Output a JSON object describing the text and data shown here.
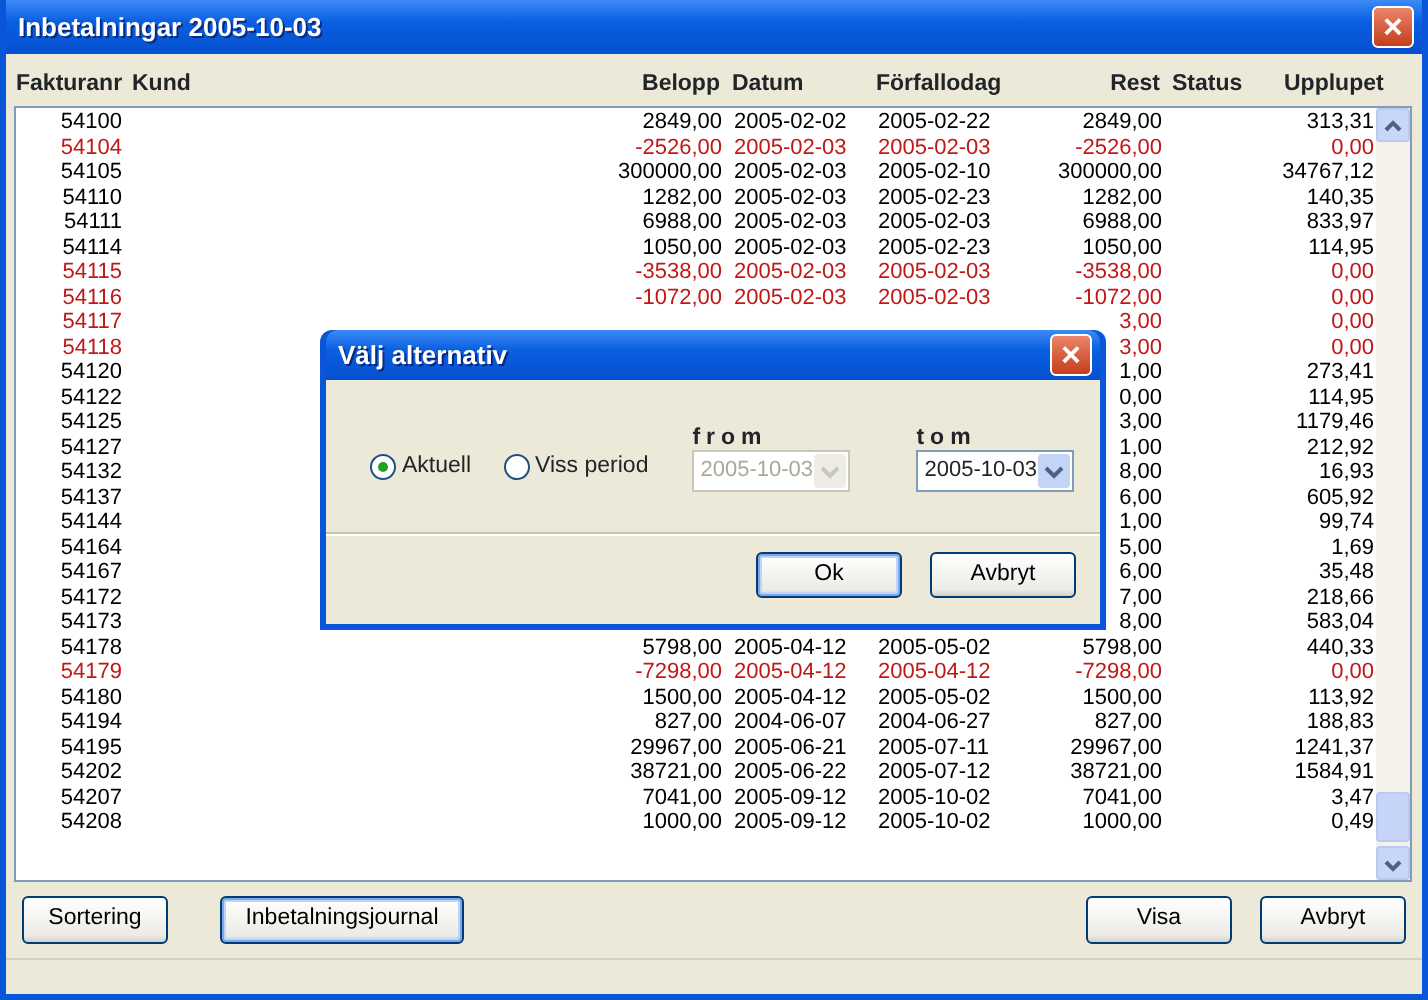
{
  "window": {
    "title": "Inbetalningar 2005-10-03",
    "close": "×"
  },
  "table": {
    "columns": [
      "Fakturanr",
      "Kund",
      "Belopp",
      "Datum",
      "Förfallodag",
      "Rest",
      "Status",
      "Upplupet"
    ],
    "rows": [
      {
        "nr": "54100",
        "color": "#000000",
        "belopp": "2849,00",
        "datum": "2005-02-02",
        "forfallodag": "2005-02-22",
        "rest": "2849,00",
        "upplupet": "313,31"
      },
      {
        "nr": "54104",
        "color": "#c01818",
        "belopp": "-2526,00",
        "datum": "2005-02-03",
        "forfallodag": "2005-02-03",
        "rest": "-2526,00",
        "upplupet": "0,00"
      },
      {
        "nr": "54105",
        "color": "#000000",
        "belopp": "300000,00",
        "datum": "2005-02-03",
        "forfallodag": "2005-02-10",
        "rest": "300000,00",
        "upplupet": "34767,12"
      },
      {
        "nr": "54110",
        "color": "#000000",
        "belopp": "1282,00",
        "datum": "2005-02-03",
        "forfallodag": "2005-02-23",
        "rest": "1282,00",
        "upplupet": "140,35"
      },
      {
        "nr": "54111",
        "color": "#000000",
        "belopp": "6988,00",
        "datum": "2005-02-03",
        "forfallodag": "2005-02-03",
        "rest": "6988,00",
        "upplupet": "833,97"
      },
      {
        "nr": "54114",
        "color": "#000000",
        "belopp": "1050,00",
        "datum": "2005-02-03",
        "forfallodag": "2005-02-23",
        "rest": "1050,00",
        "upplupet": "114,95"
      },
      {
        "nr": "54115",
        "color": "#c01818",
        "belopp": "-3538,00",
        "datum": "2005-02-03",
        "forfallodag": "2005-02-03",
        "rest": "-3538,00",
        "upplupet": "0,00"
      },
      {
        "nr": "54116",
        "color": "#c01818",
        "belopp": "-1072,00",
        "datum": "2005-02-03",
        "forfallodag": "2005-02-03",
        "rest": "-1072,00",
        "upplupet": "0,00"
      },
      {
        "nr": "54117",
        "color": "#c01818",
        "rest": "3,00",
        "upplupet": "0,00"
      },
      {
        "nr": "54118",
        "color": "#c01818",
        "rest": "3,00",
        "upplupet": "0,00"
      },
      {
        "nr": "54120",
        "color": "#000000",
        "rest": "1,00",
        "upplupet": "273,41"
      },
      {
        "nr": "54122",
        "color": "#000000",
        "rest": "0,00",
        "upplupet": "114,95"
      },
      {
        "nr": "54125",
        "color": "#000000",
        "rest": "3,00",
        "upplupet": "1179,46"
      },
      {
        "nr": "54127",
        "color": "#000000",
        "rest": "1,00",
        "upplupet": "212,92"
      },
      {
        "nr": "54132",
        "color": "#000000",
        "rest": "8,00",
        "upplupet": "16,93"
      },
      {
        "nr": "54137",
        "color": "#000000",
        "rest": "6,00",
        "upplupet": "605,92"
      },
      {
        "nr": "54144",
        "color": "#000000",
        "rest": "1,00",
        "upplupet": "99,74"
      },
      {
        "nr": "54164",
        "color": "#000000",
        "rest": "5,00",
        "upplupet": "1,69"
      },
      {
        "nr": "54167",
        "color": "#000000",
        "rest": "6,00",
        "upplupet": "35,48"
      },
      {
        "nr": "54172",
        "color": "#000000",
        "rest": "7,00",
        "upplupet": "218,66"
      },
      {
        "nr": "54173",
        "color": "#000000",
        "rest": "8,00",
        "upplupet": "583,04"
      },
      {
        "nr": "54178",
        "color": "#000000",
        "belopp": "5798,00",
        "datum": "2005-04-12",
        "forfallodag": "2005-05-02",
        "rest": "5798,00",
        "upplupet": "440,33"
      },
      {
        "nr": "54179",
        "color": "#c01818",
        "belopp": "-7298,00",
        "datum": "2005-04-12",
        "forfallodag": "2005-04-12",
        "rest": "-7298,00",
        "upplupet": "0,00"
      },
      {
        "nr": "54180",
        "color": "#000000",
        "belopp": "1500,00",
        "datum": "2005-04-12",
        "forfallodag": "2005-05-02",
        "rest": "1500,00",
        "upplupet": "113,92"
      },
      {
        "nr": "54194",
        "color": "#000000",
        "belopp": "827,00",
        "datum": "2004-06-07",
        "forfallodag": "2004-06-27",
        "rest": "827,00",
        "upplupet": "188,83"
      },
      {
        "nr": "54195",
        "color": "#000000",
        "belopp": "29967,00",
        "datum": "2005-06-21",
        "forfallodag": "2005-07-11",
        "rest": "29967,00",
        "upplupet": "1241,37"
      },
      {
        "nr": "54202",
        "color": "#000000",
        "belopp": "38721,00",
        "datum": "2005-06-22",
        "forfallodag": "2005-07-12",
        "rest": "38721,00",
        "upplupet": "1584,91"
      },
      {
        "nr": "54207",
        "color": "#000000",
        "belopp": "7041,00",
        "datum": "2005-09-12",
        "forfallodag": "2005-10-02",
        "rest": "7041,00",
        "upplupet": "3,47"
      },
      {
        "nr": "54208",
        "color": "#000000",
        "belopp": "1000,00",
        "datum": "2005-09-12",
        "forfallodag": "2005-10-02",
        "rest": "1000,00",
        "upplupet": "0,49"
      }
    ]
  },
  "buttons": [
    {
      "label": "Sortering",
      "default": false
    },
    {
      "label": "Inbetalningsjournal",
      "default": true
    },
    {
      "label": "Visa",
      "default": false
    },
    {
      "label": "Avbryt",
      "default": false
    }
  ],
  "dialog": {
    "title": "Välj alternativ",
    "close": "×",
    "radios": [
      {
        "label": "Aktuell",
        "selected": true
      },
      {
        "label": "Viss period",
        "selected": false
      }
    ],
    "dates": [
      {
        "label": "from",
        "value": "2005-10-03",
        "disabled": true
      },
      {
        "label": "tom",
        "value": "2005-10-03",
        "disabled": false
      }
    ],
    "buttons": [
      {
        "label": "Ok",
        "default": true
      },
      {
        "label": "Avbryt",
        "default": false
      }
    ]
  }
}
